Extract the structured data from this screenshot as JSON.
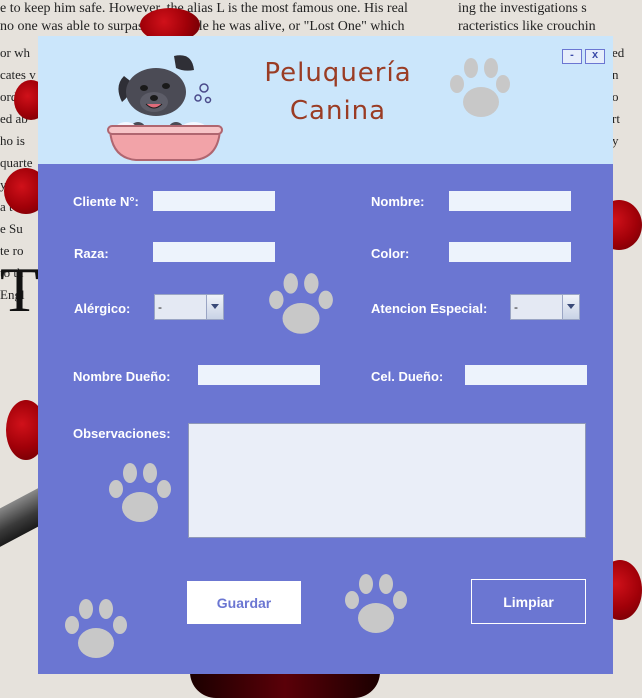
{
  "background": {
    "top_left_lines": [
      "e to keep him safe. However, the alias L is the most famous one. His real",
      "no one was able to surpass him while he was alive, or \"Lost One\" which"
    ],
    "top_right_lines": [
      "ing the investigations s",
      "racteristics like crouchin"
    ],
    "side_left_lines": [
      "or wh",
      "cates v",
      "ord hi",
      "ed ab",
      "ho is",
      "quarte",
      "yuzak",
      "a tv",
      "e Su",
      "te ro",
      "to th",
      "Engl"
    ],
    "side_right_lines": [
      "ed",
      "n",
      "o",
      "rt",
      "y"
    ],
    "big_letter": "TF"
  },
  "window": {
    "title_line1": "Peluquería",
    "title_line2": "Canina",
    "minimize_label": "-",
    "close_label": "x"
  },
  "form": {
    "cliente_label": "Cliente N°:",
    "cliente_value": "",
    "nombre_label": "Nombre:",
    "nombre_value": "",
    "raza_label": "Raza:",
    "raza_value": "",
    "color_label": "Color:",
    "color_value": "",
    "alergico_label": "Alérgico:",
    "alergico_value": "-",
    "atencion_label": "Atencion Especial:",
    "atencion_value": "-",
    "dueno_label": "Nombre Dueño:",
    "dueno_value": "",
    "cel_label": "Cel. Dueño:",
    "cel_value": "",
    "observaciones_label": "Observaciones:",
    "observaciones_value": ""
  },
  "buttons": {
    "guardar": "Guardar",
    "limpiar": "Limpiar"
  },
  "colors": {
    "window_bg": "#6b76d2",
    "header_bg": "#cbe6fb",
    "title": "#9a3c24",
    "paw": "#c8c8c8"
  },
  "icons": [
    "dog-in-bathtub-logo",
    "paw-icon"
  ]
}
